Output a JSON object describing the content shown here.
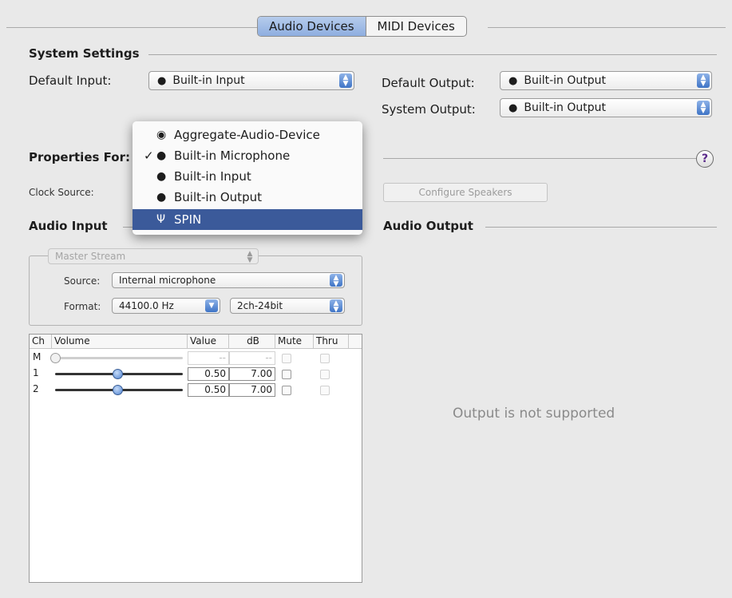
{
  "tabs": {
    "audio_devices": "Audio Devices",
    "midi_devices": "MIDI Devices"
  },
  "system_settings": {
    "title": "System Settings",
    "default_input_label": "Default Input:",
    "default_input_value": "Built-in Input",
    "default_output_label": "Default Output:",
    "default_output_value": "Built-in Output",
    "system_output_label": "System Output:",
    "system_output_value": "Built-in Output"
  },
  "properties": {
    "label": "Properties For:",
    "clock_source_label": "Clock Source:",
    "configure_speakers_label": "Configure Speakers",
    "help_symbol": "?"
  },
  "menu": {
    "items": [
      {
        "label": "Aggregate-Audio-Device",
        "icon": "aggregate-device-icon",
        "checked": false
      },
      {
        "label": "Built-in Microphone",
        "icon": "apple-icon",
        "checked": true
      },
      {
        "label": "Built-in Input",
        "icon": "apple-icon",
        "checked": false
      },
      {
        "label": "Built-in Output",
        "icon": "apple-icon",
        "checked": false
      },
      {
        "label": "SPIN",
        "icon": "usb-icon",
        "checked": false,
        "highlighted": true
      }
    ],
    "check_glyph": "✓"
  },
  "audio_input": {
    "title": "Audio Input",
    "stream_value": "Master Stream",
    "source_label": "Source:",
    "source_value": "Internal microphone",
    "format_label": "Format:",
    "rate_value": "44100.0 Hz",
    "bits_value": "2ch-24bit",
    "table": {
      "headers": [
        "Ch",
        "Volume",
        "Value",
        "dB",
        "Mute",
        "Thru"
      ],
      "rows": [
        {
          "ch": "M",
          "value": "--",
          "db": "--",
          "volume": 0.0,
          "enabled": false
        },
        {
          "ch": "1",
          "value": "0.50",
          "db": "7.00",
          "volume": 0.5,
          "enabled": true
        },
        {
          "ch": "2",
          "value": "0.50",
          "db": "7.00",
          "volume": 0.5,
          "enabled": true
        }
      ]
    }
  },
  "audio_output": {
    "title": "Audio Output",
    "message": "Output is not supported"
  },
  "colors": {
    "tab_selected": "#9fbbe6",
    "menu_highlight": "#3b5a9a",
    "stepper_blue": "#3f74c6"
  }
}
